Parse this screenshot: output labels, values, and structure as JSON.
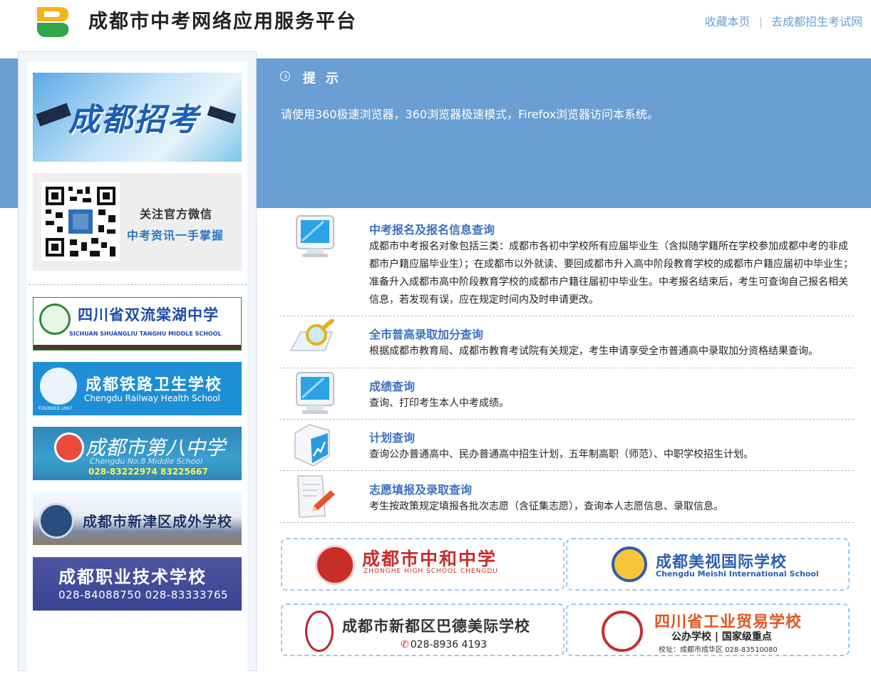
{
  "header": {
    "title": "成都市中考网络应用服务平台",
    "links": [
      "收藏本页",
      "去成都招生考试网"
    ],
    "logo_colors": [
      "#f5b21b",
      "#2fa64a"
    ]
  },
  "notice": {
    "icon": "circle-chevron-right-icon",
    "title": "提示",
    "text": "请使用360极速浏览器，360浏览器极速模式，Firefox浏览器访问本系统。"
  },
  "sidebar": {
    "top_banner": "成都招考",
    "wechat": {
      "line1": "关注官方微信",
      "line2": "中考资讯一手掌握"
    },
    "ads": [
      {
        "name": "四川省双流棠湖中学",
        "en": "SICHUAN SHUANGLIU TANGHU MIDDLE SCHOOL"
      },
      {
        "name": "成都铁路卫生学校",
        "en": "Chengdu Railway Health School",
        "note": "FOUNDED 1967"
      },
      {
        "name": "成都市第八中学",
        "en": "Chengdu No.8 Middle School",
        "phone": "028-83222974  83225667"
      },
      {
        "name": "成都市新津区成外学校"
      },
      {
        "name": "成都职业技术学校",
        "phone": "028-84088750   028-83333765"
      }
    ]
  },
  "services": [
    {
      "icon": "monitor-icon",
      "title": "中考报名及报名信息查询",
      "desc": "成都市中考报名对象包括三类：成都市各初中学校所有应届毕业生（含拟随学籍所在学校参加成都中考的非成都市户籍应届毕业生）；在成都市以外就读、要回成都市升入高中阶段教育学校的成都市户籍应届初中毕业生；准备升入成都市高中阶段教育学校的成都市户籍往届初中毕业生。中考报名结束后，考生可查询自己报名相关信息，若发现有误，应在规定时间内及时申请更改。"
    },
    {
      "icon": "magnifier-icon",
      "title": "全市普高录取加分查询",
      "desc": "根据成都市教育局、成都市教育考试院有关规定，考生申请享受全市普通高中录取加分资格结果查询。"
    },
    {
      "icon": "monitor-icon",
      "title": "成绩查询",
      "desc": "查询、打印考生本人中考成绩。"
    },
    {
      "icon": "chart-box-icon",
      "title": "计划查询",
      "desc": "查询公办普通高中、民办普通高中招生计划，五年制高职（师范）、中职学校招生计划。"
    },
    {
      "icon": "document-pen-icon",
      "title": "志愿填报及录取查询",
      "desc": "考生按政策规定填报各批次志愿（含征集志愿），查询本人志愿信息、录取信息。"
    }
  ],
  "partners": [
    {
      "name": "成都市中和中学",
      "en": "ZHONGHE HIGH SCHOOL CHENGDU"
    },
    {
      "name": "成都美视国际学校",
      "en": "Chengdu Meishi International School"
    },
    {
      "name": "成都市新都区巴德美际学校",
      "phone": "028-8936 4193"
    },
    {
      "name": "四川省工业贸易学校",
      "tag": "公办学校 | 国家级重点",
      "addr": "校址：成都市成华区  028-83510080"
    }
  ]
}
